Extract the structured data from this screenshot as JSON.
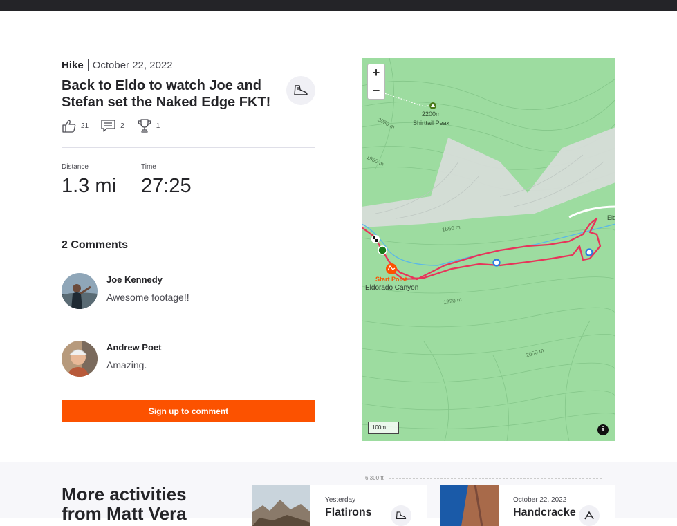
{
  "activity": {
    "type": "Hike",
    "date": "October 22, 2022",
    "title": "Back to Eldo to watch Joe and Stefan set the Naked Edge FKT!",
    "sport_icon": "hiking-boot-icon",
    "kudos_count": "21",
    "comment_count": "2",
    "achievement_count": "1"
  },
  "stats": [
    {
      "label": "Distance",
      "value": "1.3 mi"
    },
    {
      "label": "Time",
      "value": "27:25"
    }
  ],
  "comments": {
    "heading": "2 Comments",
    "items": [
      {
        "name": "Joe Kennedy",
        "text": "Awesome footage!!"
      },
      {
        "name": "Andrew Poet",
        "text": "Amazing."
      }
    ],
    "signup_label": "Sign up to comment"
  },
  "map": {
    "zoom_in": "+",
    "zoom_out": "−",
    "peak_elevation": "2200m",
    "peak_name": "Shirttail Peak",
    "start_label": "Start Point",
    "place_label": "Eldorado Canyon",
    "contours": [
      "2030 m",
      "1950 m",
      "1860 m",
      "1920 m",
      "2050 m"
    ],
    "edge_label": "Eld",
    "scale_label": "100m",
    "info_label": "i",
    "colors": {
      "terrain": "#9ddca0",
      "route": "#e8345a",
      "start": "#fc5200",
      "river": "#5bb8e8"
    }
  },
  "more": {
    "heading": "More activities from Matt Vera",
    "elevation_label": "6,300 ft",
    "cards": [
      {
        "date": "Yesterday",
        "title": "Flatirons"
      },
      {
        "date": "October 22, 2022",
        "title": "Handcracke"
      }
    ]
  }
}
